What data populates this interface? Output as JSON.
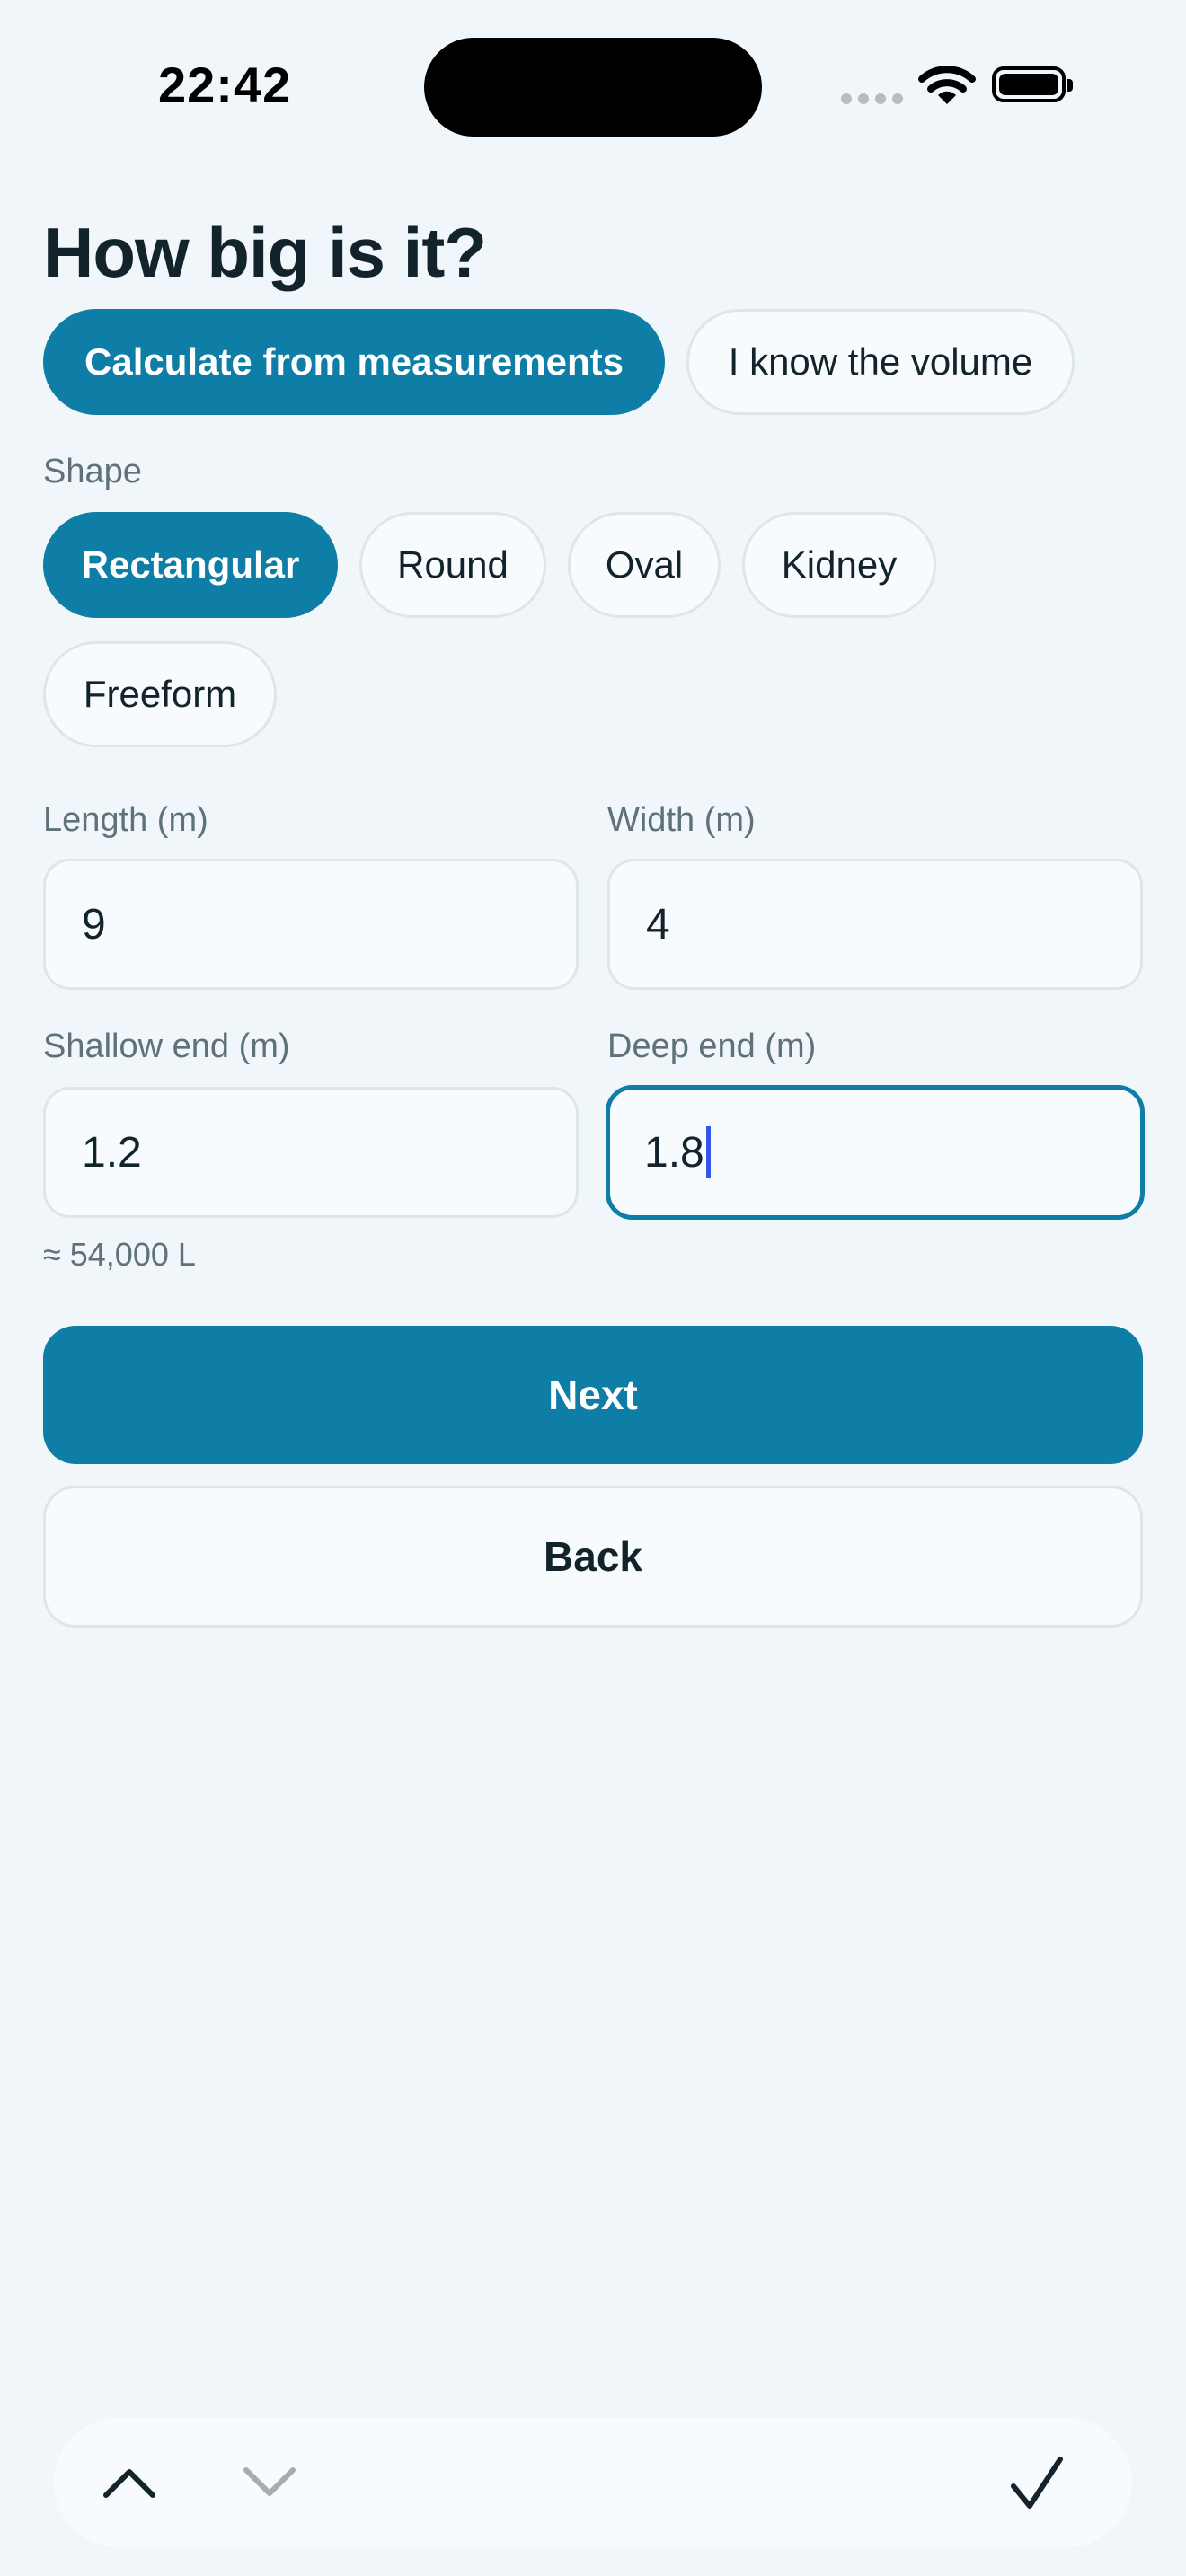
{
  "status_bar": {
    "time": "22:42"
  },
  "page": {
    "title": "How big is it?"
  },
  "mode_toggle": {
    "measure_label": "Calculate from measurements",
    "volume_label": "I know the volume",
    "selected": "measure"
  },
  "shape": {
    "label": "Shape",
    "options": [
      "Rectangular",
      "Round",
      "Oval",
      "Kidney",
      "Freeform"
    ],
    "selected": "Rectangular"
  },
  "fields": {
    "length": {
      "label": "Length (m)",
      "value": "9"
    },
    "width": {
      "label": "Width (m)",
      "value": "4"
    },
    "shallow": {
      "label": "Shallow end (m)",
      "value": "1.2"
    },
    "deep": {
      "label": "Deep end (m)",
      "value": "1.8"
    }
  },
  "estimate": "≈ 54,000 L",
  "buttons": {
    "next": "Next",
    "back": "Back"
  },
  "keyboard_toolbar": {
    "icons": [
      "chevron-up-icon",
      "chevron-down-icon",
      "checkmark-icon"
    ]
  },
  "colors": {
    "accent": "#0e7ea6",
    "background": "#f0f6f9",
    "caret": "#3355ee"
  }
}
